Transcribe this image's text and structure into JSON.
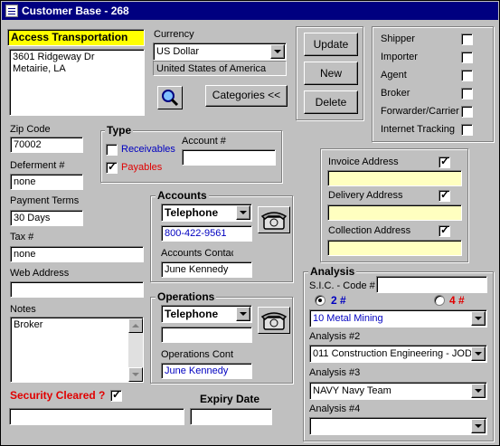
{
  "window": {
    "title": "Customer Base - 268"
  },
  "customer": {
    "name": "Access Transportation",
    "address_line1": "3601 Ridgeway Dr",
    "address_line2": "Metairie, LA"
  },
  "currency": {
    "label": "Currency",
    "value": "US Dollar",
    "country": "United States of America"
  },
  "buttons": {
    "update": "Update",
    "new": "New",
    "delete": "Delete",
    "categories": "Categories <<"
  },
  "roles": [
    {
      "label": "Shipper",
      "checked": false
    },
    {
      "label": "Importer",
      "checked": false
    },
    {
      "label": "Agent",
      "checked": false
    },
    {
      "label": "Broker",
      "checked": false
    },
    {
      "label": "Forwarder/Carrier",
      "checked": false
    },
    {
      "label": "Internet Tracking",
      "checked": false
    }
  ],
  "left": {
    "zip_label": "Zip Code",
    "zip_value": "70002",
    "deferment_label": "Deferment #",
    "deferment_value": "none",
    "payment_label": "Payment Terms",
    "payment_value": "30 Days",
    "tax_label": "Tax #",
    "tax_value": "none",
    "web_label": "Web Address",
    "web_value": "",
    "notes_label": "Notes",
    "notes_value": "Broker"
  },
  "type": {
    "title": "Type",
    "receivables": "Receivables",
    "payables": "Payables",
    "account_label": "Account #",
    "account_value": ""
  },
  "addresses": {
    "invoice": "Invoice Address",
    "delivery": "Delivery Address",
    "collection": "Collection Address"
  },
  "accounts": {
    "title": "Accounts",
    "method": "Telephone",
    "phone": "800-422-9561",
    "contact_label": "Accounts Contac",
    "contact_value": "June Kennedy"
  },
  "operations": {
    "title": "Operations",
    "method": "Telephone",
    "phone": "",
    "contact_label": "Operations Conta",
    "contact_value": "June Kennedy"
  },
  "analysis": {
    "title": "Analysis",
    "sic_label": "S.I.C. - Code #",
    "sic_value": "",
    "radio2": "2 #",
    "radio4": "4 #",
    "analysis1_value": "10 Metal Mining",
    "analysis2_label": "Analysis #2",
    "analysis2_value": "011 Construction Engineering - JOD",
    "analysis3_label": "Analysis #3",
    "analysis3_value": "NAVY Navy Team",
    "analysis4_label": "Analysis #4",
    "analysis4_value": ""
  },
  "security": {
    "label": "Security Cleared ?",
    "value": "",
    "expiry_label": "Expiry Date",
    "expiry_value": ""
  },
  "colors": {
    "title_bar": "#000080",
    "highlight": "#ffff00",
    "address_fill": "#ffffc0",
    "accent_red": "#e00000",
    "accent_blue": "#0000c0"
  }
}
